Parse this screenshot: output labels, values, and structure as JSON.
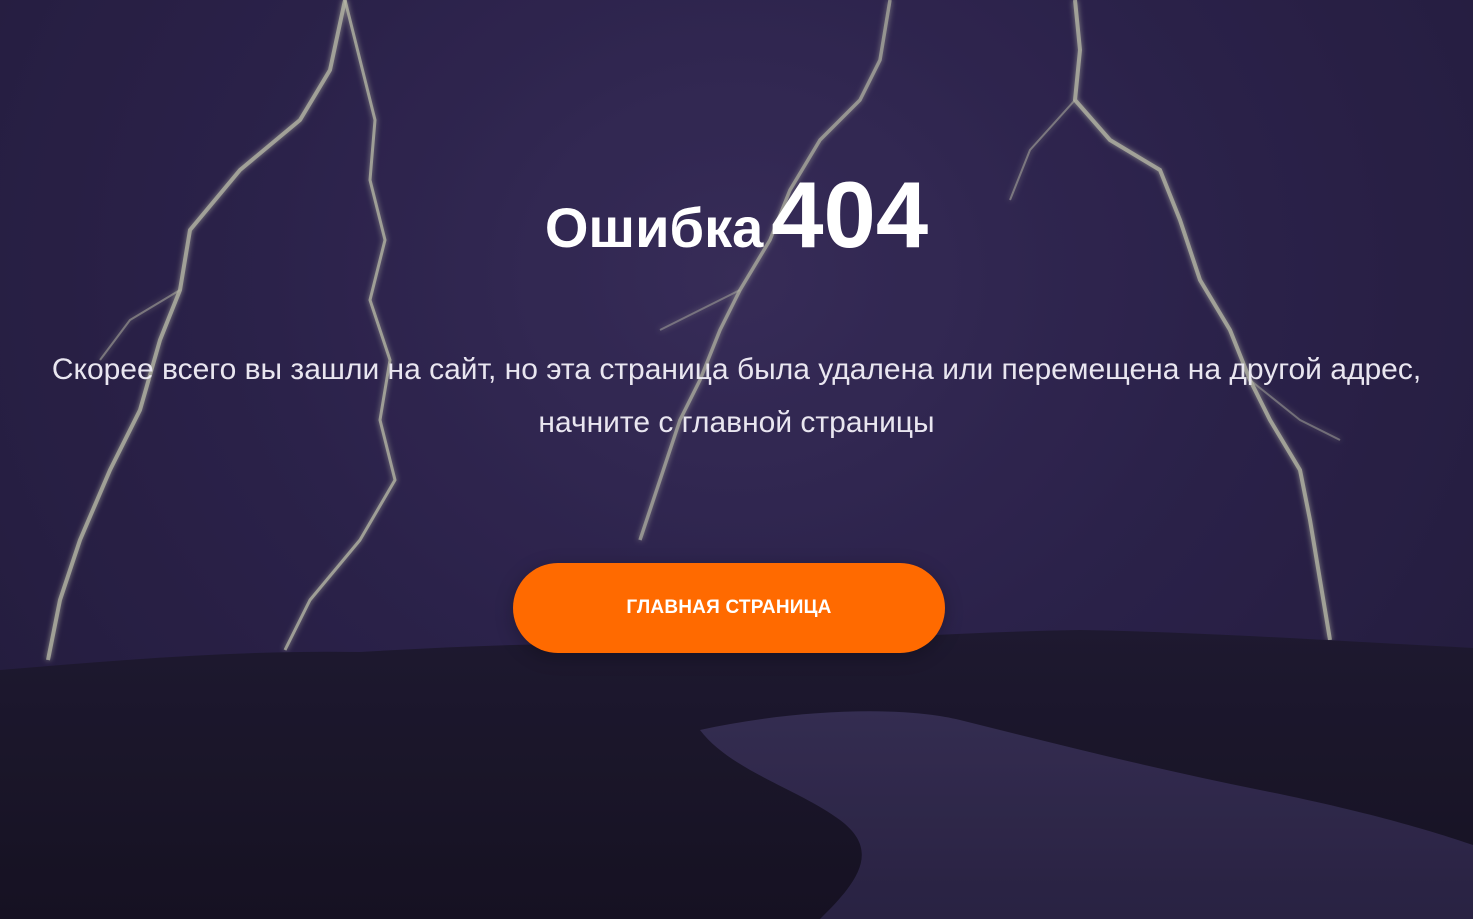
{
  "error": {
    "word": "Ошибка",
    "code": "404"
  },
  "message": "Скорее всего вы зашли на сайт, но эта страница была удалена или перемещена на другой адрес, начните с главной страницы",
  "home_button": {
    "label": "ГЛАВНАЯ СТРАНИЦА"
  },
  "colors": {
    "background": "#2f2550",
    "button": "#ff6a00",
    "text": "#ffffff"
  },
  "background_image": "lightning-storm-over-river"
}
